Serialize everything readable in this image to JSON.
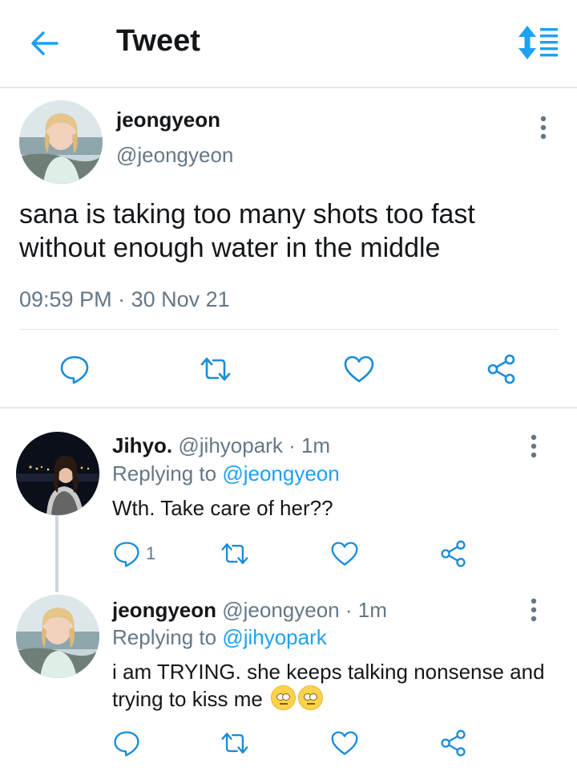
{
  "header": {
    "title": "Tweet",
    "back_icon": "back-arrow-icon",
    "sort_icon": "sort-list-icon",
    "accent_color": "#1da1f2"
  },
  "main_tweet": {
    "author_name": "jeongyeon",
    "author_handle": "@jeongyeon",
    "text": "sana is taking too many shots too fast without enough water in the middle",
    "time": "09:59 PM",
    "separator": "·",
    "date": "30 Nov 21",
    "actions": [
      "reply-icon",
      "retweet-icon",
      "like-icon",
      "share-icon"
    ]
  },
  "replies": [
    {
      "author_name": "Jihyo.",
      "author_handle": "@jihyopark",
      "age": "· 1m",
      "replying_prefix": "Replying to ",
      "replying_to": "@jeongyeon",
      "text": "Wth. Take care of her??",
      "reply_count": "1"
    },
    {
      "author_name": "jeongyeon",
      "author_handle": "@jeongyeon",
      "age": "· 1m",
      "replying_prefix": "Replying to ",
      "replying_to": "@jihyopark",
      "text": "i am TRYING. she keeps talking nonsense and trying to kiss me",
      "emojis": [
        "eye-roll-emoji",
        "eye-roll-emoji"
      ]
    }
  ]
}
